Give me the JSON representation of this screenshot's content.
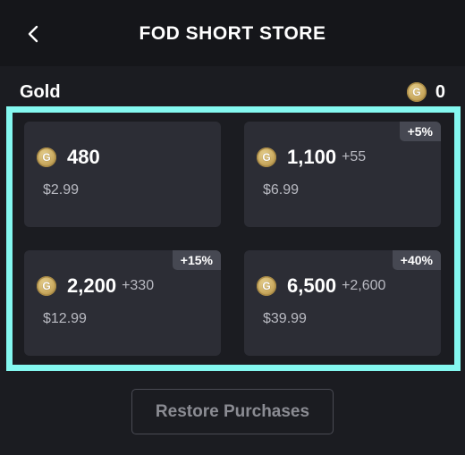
{
  "header": {
    "title": "FOD SHORT STORE",
    "back_icon": "chevron-left-icon"
  },
  "section": {
    "label": "Gold",
    "balance": "0",
    "coin_letter": "G"
  },
  "packages": [
    {
      "amount": "480",
      "bonus": "",
      "price": "$2.99",
      "badge": ""
    },
    {
      "amount": "1,100",
      "bonus": "+55",
      "price": "$6.99",
      "badge": "+5%"
    },
    {
      "amount": "2,200",
      "bonus": "+330",
      "price": "$12.99",
      "badge": "+15%"
    },
    {
      "amount": "6,500",
      "bonus": "+2,600",
      "price": "$39.99",
      "badge": "+40%"
    }
  ],
  "restore_label": "Restore Purchases",
  "colors": {
    "background": "#1b1c21",
    "header": "#15161a",
    "card": "#2c2d35",
    "highlight": "#84f8f0",
    "coin": "#c9a95f"
  }
}
